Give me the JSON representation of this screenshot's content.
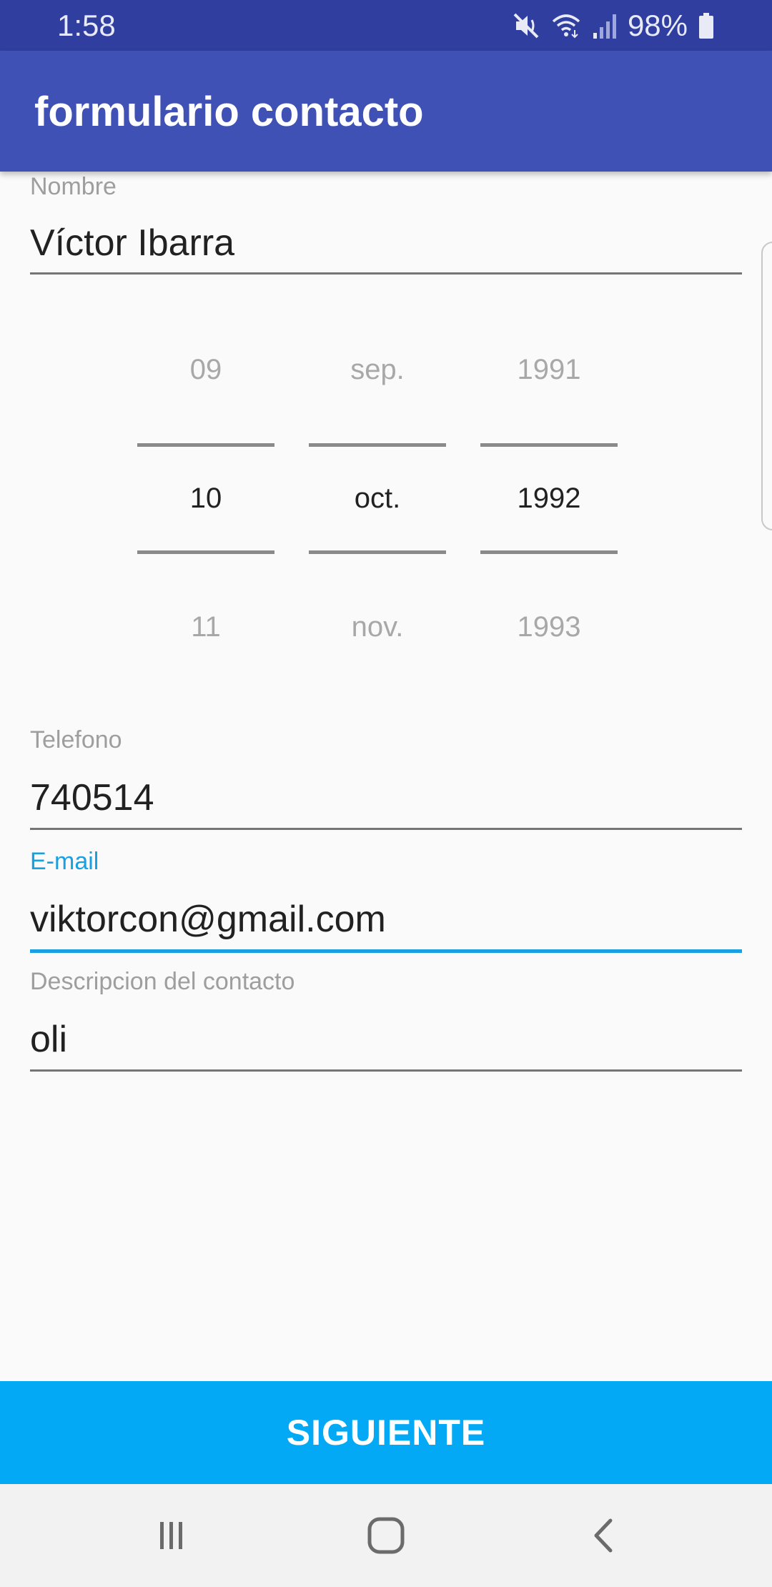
{
  "status_bar": {
    "time": "1:58",
    "battery": "98%",
    "icons": [
      "mute-vibrate-icon",
      "wifi-icon",
      "signal-icon",
      "battery-icon"
    ]
  },
  "app_bar": {
    "title": "formulario contacto"
  },
  "form": {
    "nombre": {
      "label": "Nombre",
      "value": "Víctor Ibarra"
    },
    "date_picker": {
      "day": {
        "prev": "09",
        "selected": "10",
        "next": "11"
      },
      "month": {
        "prev": "sep.",
        "selected": "oct.",
        "next": "nov."
      },
      "year": {
        "prev": "1991",
        "selected": "1992",
        "next": "1993"
      }
    },
    "telefono": {
      "label": "Telefono",
      "value": "740514"
    },
    "email": {
      "label": "E-mail",
      "value": "viktorcon@gmail.com"
    },
    "descripcion": {
      "label": "Descripcion del contacto",
      "value": "oli"
    }
  },
  "next_button": {
    "label": "SIGUIENTE"
  },
  "nav_bar": {
    "icons": [
      "recent-apps-icon",
      "home-icon",
      "back-icon"
    ]
  },
  "colors": {
    "status_bar": "#303f9f",
    "app_bar": "#3f51b5",
    "accent": "#03a9f4",
    "focus": "#1aa0e0"
  }
}
